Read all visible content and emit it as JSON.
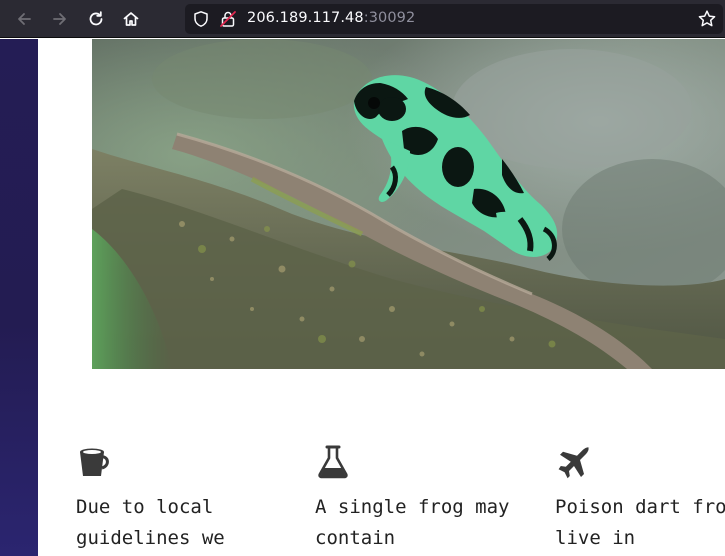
{
  "browser": {
    "url_host": "206.189.117.48",
    "url_port": ":30092",
    "icons": [
      "back-arrow-icon",
      "forward-arrow-icon",
      "reload-icon",
      "home-icon",
      "shield-icon",
      "insecure-lock-icon",
      "bookmark-star-icon"
    ]
  },
  "hero": {
    "image": "green-and-black-poison-dart-frog-on-mossy-branch"
  },
  "features": [
    {
      "icon": "bucket-icon",
      "text": "Due to local guidelines we"
    },
    {
      "icon": "flask-icon",
      "text": "A single frog may contain"
    },
    {
      "icon": "airplane-icon",
      "text": "Poison dart frogs live in"
    }
  ],
  "colors": {
    "toolbar": "#2b2a33",
    "urlbar": "#1c1b22",
    "sidebar": "#241d55",
    "text": "#222222"
  }
}
